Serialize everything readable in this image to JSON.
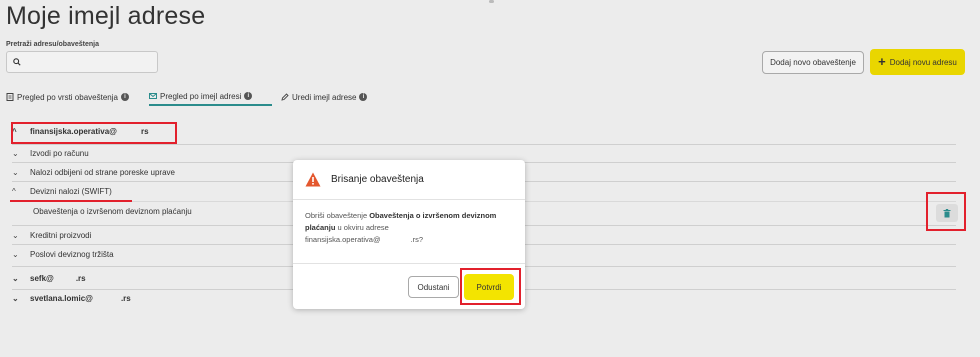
{
  "page": {
    "title": "Moje imejl adrese",
    "search": {
      "label": "Pretraži adresu/obaveštenja",
      "placeholder": ""
    },
    "buttons": {
      "add_notification": "Dodaj novo obaveštenje",
      "add_address": "Dodaj novu adresu"
    },
    "tabs": [
      {
        "label": "Pregled po vrsti obaveštenja",
        "active": false
      },
      {
        "label": "Pregled po imejl adresi",
        "active": true
      },
      {
        "label": "Uredi imejl adrese",
        "active": false
      }
    ],
    "tree": [
      {
        "label_start": "finansijska.operativa@",
        "label_end": "rs",
        "expanded": true,
        "level": 0
      },
      {
        "label": "Izvodi po računu",
        "expanded": false,
        "level": 1
      },
      {
        "label": "Nalozi odbijeni od strane poreske uprave",
        "expanded": false,
        "level": 1
      },
      {
        "label": "Devizni nalozi (SWIFT)",
        "expanded": true,
        "level": 1
      },
      {
        "label": "Obaveštenja o izvršenom deviznom plaćanju",
        "level": 2
      },
      {
        "label": "Kreditni proizvodi",
        "expanded": false,
        "level": 1
      },
      {
        "label": "Poslovi deviznog tržišta",
        "expanded": false,
        "level": 1
      },
      {
        "label_start": "sefk@",
        "label_end": ".rs",
        "expanded": false,
        "level": 0
      },
      {
        "label_start": "svetlana.lomic@",
        "label_end": ".rs",
        "expanded": false,
        "level": 0
      }
    ]
  },
  "modal": {
    "title": "Brisanje obaveštenja",
    "body_prefix": "Obriši obaveštenje ",
    "body_bold": "Obaveštenja o izvršenom deviznom plaćanju",
    "body_mid": " u okviru adrese",
    "body_email_start": "finansijska.operativa@",
    "body_email_end": ".rs?",
    "cancel": "Odustani",
    "confirm": "Potvrdi"
  },
  "colors": {
    "accent_yellow": "#e9d600",
    "highlight_red": "#e2202c",
    "tab_underline": "#2b8c8c",
    "warning_orange": "#e4572e"
  },
  "icons": [
    "search-icon",
    "info-icon",
    "mail-icon",
    "edit-icon",
    "plus-icon",
    "chevron-up-icon",
    "chevron-down-icon",
    "trash-icon",
    "warning-icon"
  ]
}
